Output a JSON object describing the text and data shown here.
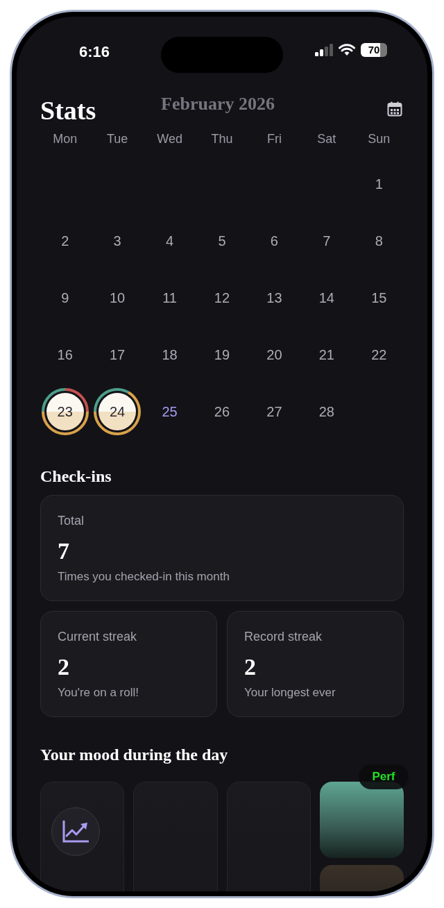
{
  "status_bar": {
    "time": "6:16",
    "battery": "70"
  },
  "header": {
    "title": "Stats",
    "month": "February 2026"
  },
  "calendar": {
    "weekdays": [
      "Mon",
      "Tue",
      "Wed",
      "Thu",
      "Fri",
      "Sat",
      "Sun"
    ],
    "weeks": [
      [
        {
          "kind": "blank"
        },
        {
          "kind": "blank"
        },
        {
          "kind": "blank"
        },
        {
          "kind": "blank"
        },
        {
          "kind": "blank"
        },
        {
          "kind": "blank"
        },
        {
          "kind": "day",
          "label": "1",
          "today": false
        }
      ],
      [
        {
          "kind": "day",
          "label": "2",
          "today": false
        },
        {
          "kind": "day",
          "label": "3",
          "today": false
        },
        {
          "kind": "day",
          "label": "4",
          "today": false
        },
        {
          "kind": "day",
          "label": "5",
          "today": false
        },
        {
          "kind": "day",
          "label": "6",
          "today": false
        },
        {
          "kind": "day",
          "label": "7",
          "today": false
        },
        {
          "kind": "day",
          "label": "8",
          "today": false
        }
      ],
      [
        {
          "kind": "day",
          "label": "9",
          "today": false
        },
        {
          "kind": "day",
          "label": "10",
          "today": false
        },
        {
          "kind": "day",
          "label": "11",
          "today": false
        },
        {
          "kind": "day",
          "label": "12",
          "today": false
        },
        {
          "kind": "day",
          "label": "13",
          "today": false
        },
        {
          "kind": "day",
          "label": "14",
          "today": false
        },
        {
          "kind": "day",
          "label": "15",
          "today": false
        }
      ],
      [
        {
          "kind": "day",
          "label": "16",
          "today": false
        },
        {
          "kind": "day",
          "label": "17",
          "today": false
        },
        {
          "kind": "day",
          "label": "18",
          "today": false
        },
        {
          "kind": "day",
          "label": "19",
          "today": false
        },
        {
          "kind": "day",
          "label": "20",
          "today": false
        },
        {
          "kind": "day",
          "label": "21",
          "today": false
        },
        {
          "kind": "day",
          "label": "22",
          "today": false
        }
      ],
      [
        {
          "kind": "mood_day",
          "label": "23",
          "today": false,
          "ring": [
            {
              "color": "#4c9e8a"
            },
            {
              "color": "#c2524f"
            },
            {
              "color": "#d9a24a"
            },
            {
              "color": "#d9a24a"
            }
          ]
        },
        {
          "kind": "mood_day",
          "label": "24",
          "today": false,
          "ring": [
            {
              "color": "#4c9e8a"
            },
            {
              "color": "#d9a24a"
            },
            {
              "color": "#d9a24a"
            }
          ]
        },
        {
          "kind": "day",
          "label": "25",
          "today": true
        },
        {
          "kind": "day",
          "label": "26",
          "today": false
        },
        {
          "kind": "day",
          "label": "27",
          "today": false
        },
        {
          "kind": "day",
          "label": "28",
          "today": false
        },
        {
          "kind": "blank"
        }
      ]
    ]
  },
  "check_ins": {
    "title": "Check-ins",
    "cards": [
      {
        "label": "Total",
        "value": "7",
        "caption": "Times you checked-in this month"
      },
      {
        "label": "Current streak",
        "value": "2",
        "caption": "You're on a roll!"
      },
      {
        "label": "Record streak",
        "value": "2",
        "caption": "Your longest ever"
      }
    ]
  },
  "mood": {
    "title": "Your mood during the day",
    "columns": [
      {
        "kind": "empty"
      },
      {
        "kind": "empty"
      },
      {
        "kind": "empty"
      },
      {
        "kind": "tiles",
        "tiles": [
          {
            "color": "#5fa592"
          },
          {
            "color": "#3a3128"
          }
        ]
      }
    ]
  },
  "perf_badge": {
    "text": "Perf"
  }
}
